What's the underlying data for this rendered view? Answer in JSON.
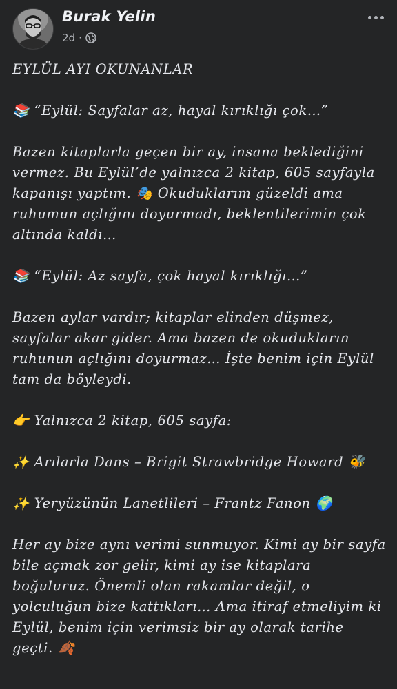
{
  "post": {
    "author": "Burak Yelin",
    "time": "2d",
    "separator": "·",
    "paragraphs": [
      "EYLÜL AYI OKUNANLAR",
      "📚 “Eylül: Sayfalar az, hayal kırıklığı çok…”",
      "Bazen kitaplarla geçen bir ay, insana beklediğini vermez. Bu Eylül’de yalnızca 2 kitap, 605 sayfayla kapanışı yaptım. 🎭 Okuduklarım güzeldi ama ruhumun açlığını doyurmadı, beklentilerimin çok altında kaldı…",
      "📚 “Eylül: Az sayfa, çok hayal kırıklığı…”",
      "Bazen aylar vardır; kitaplar elinden düşmez, sayfalar akar gider. Ama bazen de okudukların ruhunun açlığını doyurmaz… İşte benim için Eylül tam da böyleydi.",
      "👉 Yalnızca 2 kitap, 605 sayfa:",
      "✨ Arılarla Dans – Brigit Strawbridge Howard 🐝",
      "✨ Yeryüzünün Lanetlileri – Frantz Fanon 🌍",
      "Her ay bize aynı verimi sunmuyor. Kimi ay bir sayfa bile açmak zor gelir, kimi ay ise kitaplara boğuluruz. Önemli olan rakamlar değil, o yolculuğun bize kattıkları… Ama itiraf etmeliyim ki Eylül, benim için verimsiz bir ay olarak tarihe geçti. 🍂"
    ]
  },
  "icons": {
    "globe": "globe-icon",
    "more": "more-options-icon",
    "avatar": "profile-photo"
  },
  "colors": {
    "background": "#242526",
    "text": "#e4e6eb",
    "secondary_text": "#b0b3b8"
  }
}
